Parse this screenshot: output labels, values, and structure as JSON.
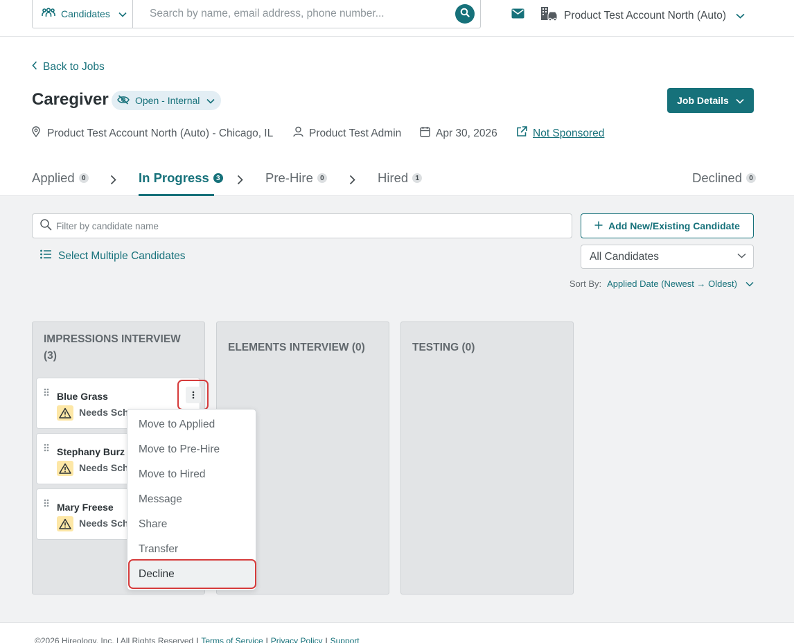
{
  "topbar": {
    "entity_label": "Candidates",
    "search_placeholder": "Search by name, email address, phone number...",
    "account_name": "Product Test Account North (Auto)"
  },
  "header": {
    "back_label": "Back to Jobs",
    "job_title": "Caregiver",
    "status_label": "Open - Internal",
    "job_details_label": "Job Details",
    "location": "Product Test Account North (Auto) - Chicago, IL",
    "owner": "Product Test Admin",
    "date": "Apr 30, 2026",
    "sponsorship": "Not Sponsored"
  },
  "tabs": [
    {
      "label": "Applied",
      "count": "0"
    },
    {
      "label": "In Progress",
      "count": "3"
    },
    {
      "label": "Pre-Hire",
      "count": "0"
    },
    {
      "label": "Hired",
      "count": "1"
    },
    {
      "label": "Declined",
      "count": "0"
    }
  ],
  "toolbar": {
    "filter_placeholder": "Filter by candidate name",
    "add_label": "Add New/Existing Candidate",
    "select_multiple_label": "Select Multiple Candidates",
    "candidate_filter_value": "All Candidates",
    "sort_label": "Sort By:",
    "sort_value": "Applied Date (Newest → Oldest)"
  },
  "columns": [
    {
      "title": "IMPRESSIONS INTERVIEW (3)"
    },
    {
      "title": "ELEMENTS INTERVIEW (0)"
    },
    {
      "title": "TESTING (0)"
    }
  ],
  "cards": [
    {
      "name": "Blue Grass",
      "status": "Needs Sche"
    },
    {
      "name": "Stephany Burz",
      "status": "Needs Sche"
    },
    {
      "name": "Mary Freese",
      "status": "Needs Sche"
    }
  ],
  "menu": {
    "items": [
      "Move to Applied",
      "Move to Pre-Hire",
      "Move to Hired",
      "Message",
      "Share",
      "Transfer"
    ],
    "decline_label": "Decline"
  },
  "footer": {
    "copyright": "©2026 Hireology, Inc. | All Rights Reserved",
    "terms": "Terms of Service",
    "privacy": "Privacy Policy",
    "support": "Support"
  },
  "colors": {
    "accent": "#16717a",
    "highlight_outline": "#d63b3b",
    "warning_bg": "#fde7a6",
    "status_pill_bg": "#e3eef4"
  },
  "icons": [
    "people-icon",
    "chevron-down-icon",
    "search-icon",
    "mail-icon",
    "building-car-icon",
    "chevron-left-icon",
    "eye-slash-icon",
    "map-pin-icon",
    "user-icon",
    "calendar-icon",
    "external-link-icon",
    "chevron-right-icon",
    "plus-icon",
    "list-icon",
    "grip-icon",
    "warning-icon",
    "kebab-icon"
  ]
}
